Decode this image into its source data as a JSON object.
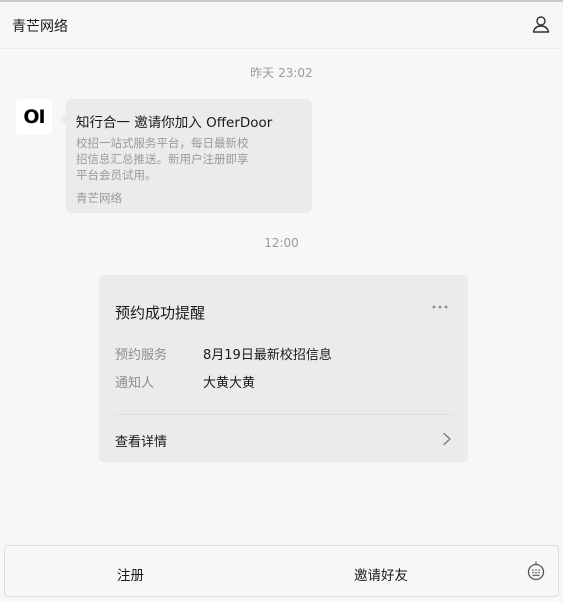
{
  "header": {
    "title": "青芒网络",
    "user_icon": "user-icon"
  },
  "messages": {
    "timestamp_1": "昨天 23:02",
    "invite": {
      "avatar_text": "OI",
      "title": "知行合一 邀请你加入 OfferDoor",
      "description": "校招一站式服务平台，每日最新校招信息汇总推送。新用户注册即享平台会员试用。",
      "source": "青芒网络"
    },
    "timestamp_2": "12:00",
    "card": {
      "title": "预约成功提醒",
      "more_icon": "more-icon",
      "rows": [
        {
          "label": "预约服务",
          "value": "8月19日最新校招信息"
        },
        {
          "label": "通知人",
          "value": "大黄大黄"
        }
      ],
      "detail_link": "查看详情",
      "chevron_icon": "chevron-right-icon"
    }
  },
  "bottom_menu": {
    "items": [
      "注册",
      "邀请好友"
    ],
    "keyboard_icon": "keyboard-icon"
  },
  "colors": {
    "page_bg": "#f7f7f7",
    "bubble_bg": "#ebebed",
    "muted_text": "#9a9a9a"
  }
}
